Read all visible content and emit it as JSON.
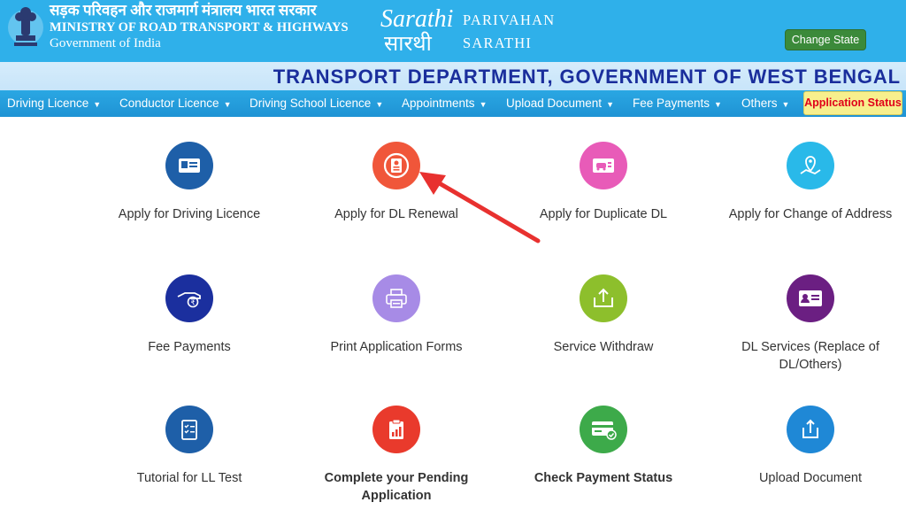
{
  "header": {
    "ministry_hindi": "सड़क परिवहन और राजमार्ग मंत्रालय भारत सरकार",
    "ministry_english": "MINISTRY OF ROAD TRANSPORT & HIGHWAYS",
    "government": "Government of India",
    "logo_text": "Sarathi",
    "logo_text_hindi": "सारथी",
    "brand_line1": "PARIVAHAN",
    "brand_line2": "SARATHI",
    "change_state": "Change State"
  },
  "department_title": "TRANSPORT DEPARTMENT, GOVERNMENT OF WEST BENGAL",
  "nav": {
    "items": [
      {
        "label": "Driving Licence"
      },
      {
        "label": "Conductor Licence"
      },
      {
        "label": "Driving School Licence"
      },
      {
        "label": "Appointments"
      },
      {
        "label": "Upload Document"
      },
      {
        "label": "Fee Payments"
      },
      {
        "label": "Others"
      }
    ],
    "application_status": "Application Status"
  },
  "tiles": [
    {
      "label": "Apply for Driving Licence",
      "icon": "id-card-icon",
      "color": "#1e5fa8"
    },
    {
      "label": "Apply for DL Renewal",
      "icon": "renewal-icon",
      "color": "#f0563a"
    },
    {
      "label": "Apply for Duplicate DL",
      "icon": "duplicate-dl-icon",
      "color": "#e85bb8"
    },
    {
      "label": "Apply for Change of Address",
      "icon": "location-icon",
      "color": "#29b9e9"
    },
    {
      "label": "Fee Payments",
      "icon": "payment-hand-icon",
      "color": "#1b2f9e"
    },
    {
      "label": "Print Application Forms",
      "icon": "printer-icon",
      "color": "#a78be6"
    },
    {
      "label": "Service Withdraw",
      "icon": "upload-tray-icon",
      "color": "#8dbf2c"
    },
    {
      "label": "DL Services (Replace of DL/Others)",
      "icon": "profile-card-icon",
      "color": "#6b1f82"
    },
    {
      "label": "Tutorial for LL Test",
      "icon": "checklist-icon",
      "color": "#1e5fa8"
    },
    {
      "label": "Complete your Pending Application",
      "icon": "clipboard-chart-icon",
      "color": "#e93a2c"
    },
    {
      "label": "Check Payment Status",
      "icon": "payment-card-icon",
      "color": "#3daa4a"
    },
    {
      "label": "Upload Document",
      "icon": "share-upload-icon",
      "color": "#1f88d6"
    }
  ],
  "colors": {
    "header_bg": "#2fb0ea",
    "nav_bg": "#1f93d4",
    "dept_title": "#1a2e9c",
    "status_bg": "#f7ef8d",
    "status_text": "#e0001b",
    "arrow": "#e8312f"
  }
}
